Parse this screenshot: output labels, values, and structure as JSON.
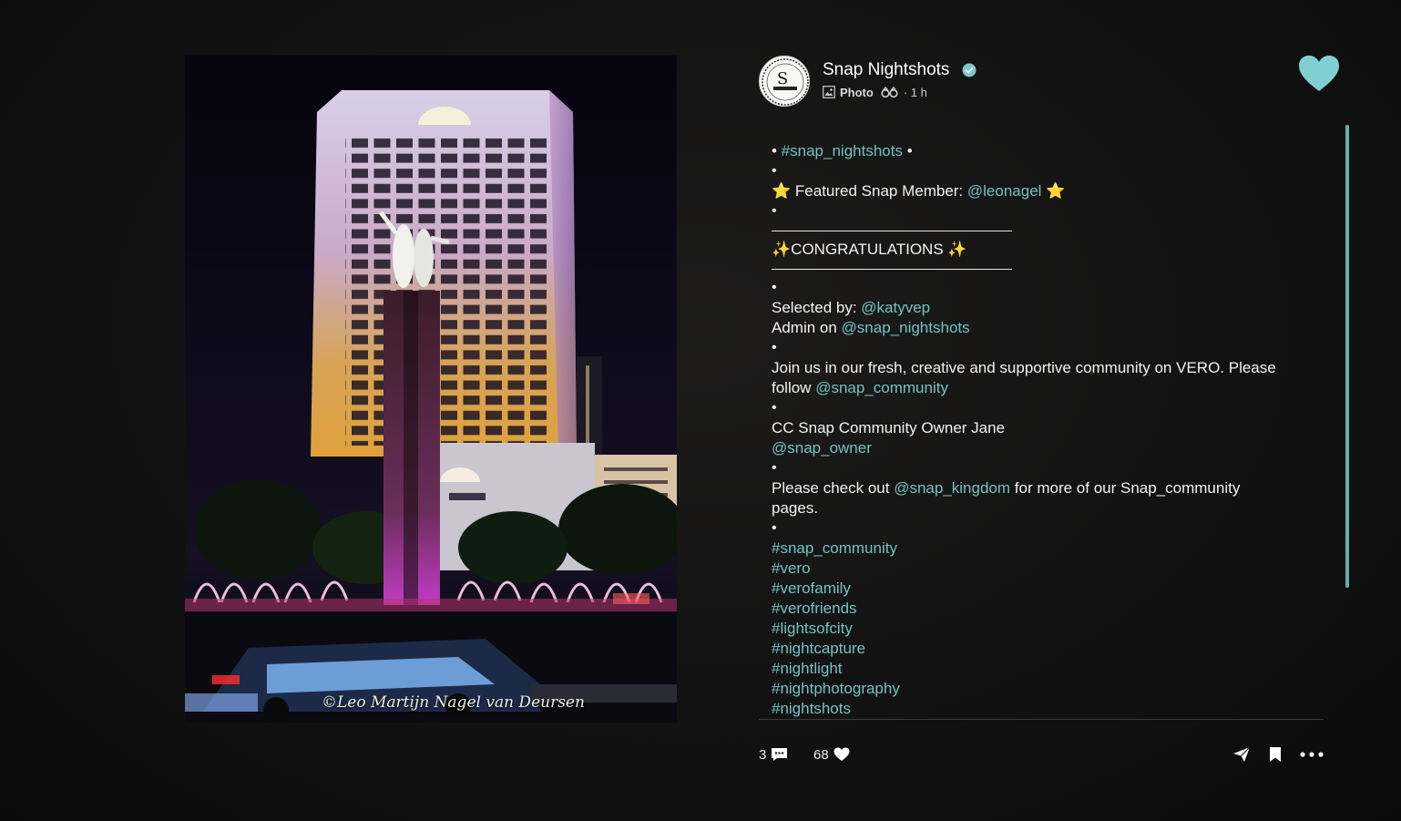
{
  "post": {
    "account_name": "Snap Nightshots",
    "post_type": "Photo",
    "time": "· 1 h",
    "photo_watermark": "©Leo Martijn Nagel van Deursen",
    "avatar_monogram": "S"
  },
  "caption": {
    "l1_pre": "• ",
    "l1_tag": "#snap_nightshots",
    "l1_post": " •",
    "dot": "•",
    "star": "⭐",
    "featured_text": " Featured Snap Member: ",
    "featured_user": "@leonagel",
    "congrats": "✨CONGRATULATIONS ✨",
    "selected_by_text": "Selected by: ",
    "selected_by_user": "@katyvep",
    "admin_text": "Admin on ",
    "admin_user": "@snap_nightshots",
    "join_text": "Join us in our fresh, creative and supportive community on VERO. Please follow ",
    "join_user": "@snap_community",
    "cc_text": "CC Snap Community Owner Jane",
    "cc_user": "@snap_owner",
    "checkout_pre": "Please check out ",
    "checkout_user": "@snap_kingdom",
    "checkout_post": " for more of our Snap_community pages.",
    "hashtags": [
      "#snap_community",
      "#vero",
      "#verofamily",
      "#verofriends",
      "#lightsofcity",
      "#nightcapture",
      "#nightlight",
      "#nightphotography",
      "#nightshots"
    ]
  },
  "footer": {
    "comments_count": "3",
    "likes_count": "68"
  },
  "icons": {
    "verified": "verified-badge-icon",
    "photo": "photo-icon",
    "visibility": "binoculars-icon",
    "like_top": "heart-icon",
    "comment": "comment-icon",
    "like": "heart-icon",
    "share": "send-icon",
    "bookmark": "bookmark-icon",
    "more": "more-icon"
  },
  "colors": {
    "accent": "#74c2c0",
    "heart": "#7fd0d3",
    "background": "#141414"
  }
}
